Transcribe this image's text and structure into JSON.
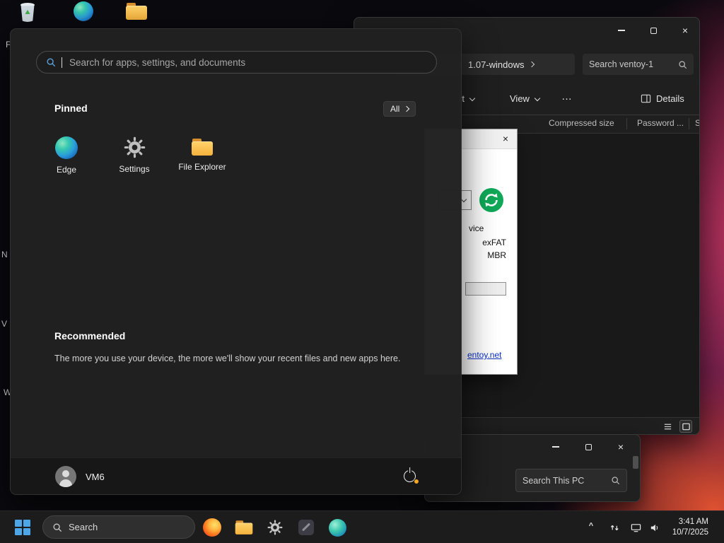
{
  "desktop": {
    "fragments": [
      {
        "text": "F"
      },
      {
        "text": "N"
      },
      {
        "text": "V"
      },
      {
        "text": "W"
      }
    ]
  },
  "icons": {
    "close_glyph": "×"
  },
  "start_menu": {
    "search_placeholder": "Search for apps, settings, and documents",
    "pinned_title": "Pinned",
    "all_button_label": "All",
    "pinned_apps": [
      {
        "label": "Edge"
      },
      {
        "label": "Settings"
      },
      {
        "label": "File Explorer"
      }
    ],
    "recommended_title": "Recommended",
    "recommended_empty_text": "The more you use your device, the more we'll show your recent files and new apps here.",
    "user_name": "VM6"
  },
  "explorer": {
    "breadcrumb_item": "1.07-windows",
    "search_value": "Search ventoy-1",
    "toolbar_sort_fragment": "rt",
    "toolbar_view": "View",
    "toolbar_more": "…",
    "toolbar_details": "Details",
    "columns": [
      "Compressed size",
      "Password ...",
      "Si"
    ]
  },
  "ventoy": {
    "device_fragment": "vice",
    "filesystem": "exFAT",
    "partition_style": "MBR",
    "link_fragment": "entoy.net"
  },
  "pc_window": {
    "search_value": "Search This PC"
  },
  "taskbar": {
    "search_label": "Search",
    "tray_chevron": "^",
    "time": "3:41 AM",
    "date": "10/7/2025"
  }
}
